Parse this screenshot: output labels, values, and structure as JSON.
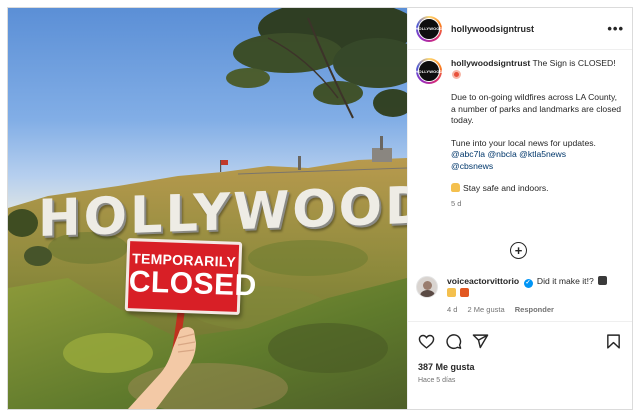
{
  "post": {
    "image": {
      "sign_letters": "HOLLYWOOD",
      "board_line1": "TEMPORARILY",
      "board_line2": "CLOSED"
    },
    "header": {
      "avatar_text": "HOLLYWOOD",
      "username": "hollywoodsigntrust",
      "more_label": "•••"
    },
    "caption": {
      "username": "hollywoodsigntrust",
      "line1": "The Sign is CLOSED!",
      "para1": "Due to on-going wildfires across LA County, a number of parks and landmarks are closed today.",
      "para2": "Tune into your local news for updates.",
      "tags": [
        "@abc7la",
        "@nbcla",
        "@ktla5news",
        "@cbsnews"
      ],
      "para3": "Stay safe and indoors.",
      "time": "5 d"
    },
    "comment": {
      "username": "voiceactorvittorio",
      "verified_mark": "✓",
      "text": "Did it make it!?",
      "time": "4 d",
      "likes": "2 Me gusta",
      "reply": "Responder"
    },
    "likes": "387 Me gusta",
    "posted": "Hace 5 días",
    "colors": {
      "link": "#00376b",
      "board": "#d81f26",
      "verified": "#0095f6",
      "muted": "#737373"
    },
    "icons": [
      "more-options-icon",
      "add-comment-icon",
      "heart-icon",
      "comment-icon",
      "share-icon",
      "bookmark-icon"
    ]
  }
}
